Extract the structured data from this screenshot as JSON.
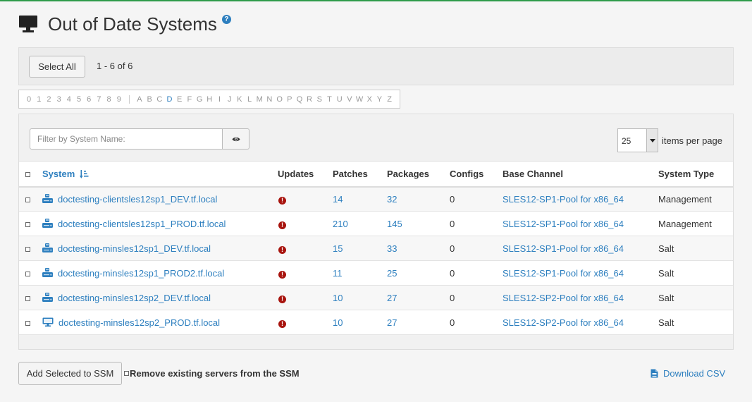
{
  "page": {
    "title": "Out of Date Systems",
    "help_glyph": "?"
  },
  "selection": {
    "select_all_label": "Select All",
    "range_text": "1 - 6 of 6"
  },
  "alpha_nav": {
    "digits": [
      "0",
      "1",
      "2",
      "3",
      "4",
      "5",
      "6",
      "7",
      "8",
      "9"
    ],
    "letters": [
      "A",
      "B",
      "C",
      "D",
      "E",
      "F",
      "G",
      "H",
      "I",
      "J",
      "K",
      "L",
      "M",
      "N",
      "O",
      "P",
      "Q",
      "R",
      "S",
      "T",
      "U",
      "V",
      "W",
      "X",
      "Y",
      "Z"
    ],
    "active": "D"
  },
  "filter": {
    "placeholder": "Filter by System Name:",
    "icon": "eye-icon"
  },
  "pagination": {
    "items_per_page": "25",
    "items_per_page_label": "items per page"
  },
  "table": {
    "columns": [
      "System",
      "Updates",
      "Patches",
      "Packages",
      "Configs",
      "Base Channel",
      "System Type"
    ],
    "rows": [
      {
        "system": "doctesting-clientsles12sp1_DEV.tf.local",
        "icon": "server-icon",
        "updates_icon": "critical-alert-icon",
        "patches": "14",
        "packages": "32",
        "configs": "0",
        "base_channel": "SLES12-SP1-Pool for x86_64",
        "system_type": "Management"
      },
      {
        "system": "doctesting-clientsles12sp1_PROD.tf.local",
        "icon": "server-icon",
        "updates_icon": "critical-alert-icon",
        "patches": "210",
        "packages": "145",
        "configs": "0",
        "base_channel": "SLES12-SP1-Pool for x86_64",
        "system_type": "Management"
      },
      {
        "system": "doctesting-minsles12sp1_DEV.tf.local",
        "icon": "server-icon",
        "updates_icon": "critical-alert-icon",
        "patches": "15",
        "packages": "33",
        "configs": "0",
        "base_channel": "SLES12-SP1-Pool for x86_64",
        "system_type": "Salt"
      },
      {
        "system": "doctesting-minsles12sp1_PROD2.tf.local",
        "icon": "server-icon",
        "updates_icon": "critical-alert-icon",
        "patches": "11",
        "packages": "25",
        "configs": "0",
        "base_channel": "SLES12-SP1-Pool for x86_64",
        "system_type": "Salt"
      },
      {
        "system": "doctesting-minsles12sp2_DEV.tf.local",
        "icon": "server-icon",
        "updates_icon": "critical-alert-icon",
        "patches": "10",
        "packages": "27",
        "configs": "0",
        "base_channel": "SLES12-SP2-Pool for x86_64",
        "system_type": "Salt"
      },
      {
        "system": "doctesting-minsles12sp2_PROD.tf.local",
        "icon": "desktop-icon",
        "updates_icon": "critical-alert-icon",
        "patches": "10",
        "packages": "27",
        "configs": "0",
        "base_channel": "SLES12-SP2-Pool for x86_64",
        "system_type": "Salt"
      }
    ]
  },
  "footer": {
    "add_ssm_label": "Add Selected to SSM",
    "remove_ssm_label": "Remove existing servers from the SSM",
    "download_csv_label": "Download CSV"
  },
  "colors": {
    "link": "#2d7fbf",
    "alert": "#a8140e",
    "top_bar": "#2e9b4b"
  }
}
